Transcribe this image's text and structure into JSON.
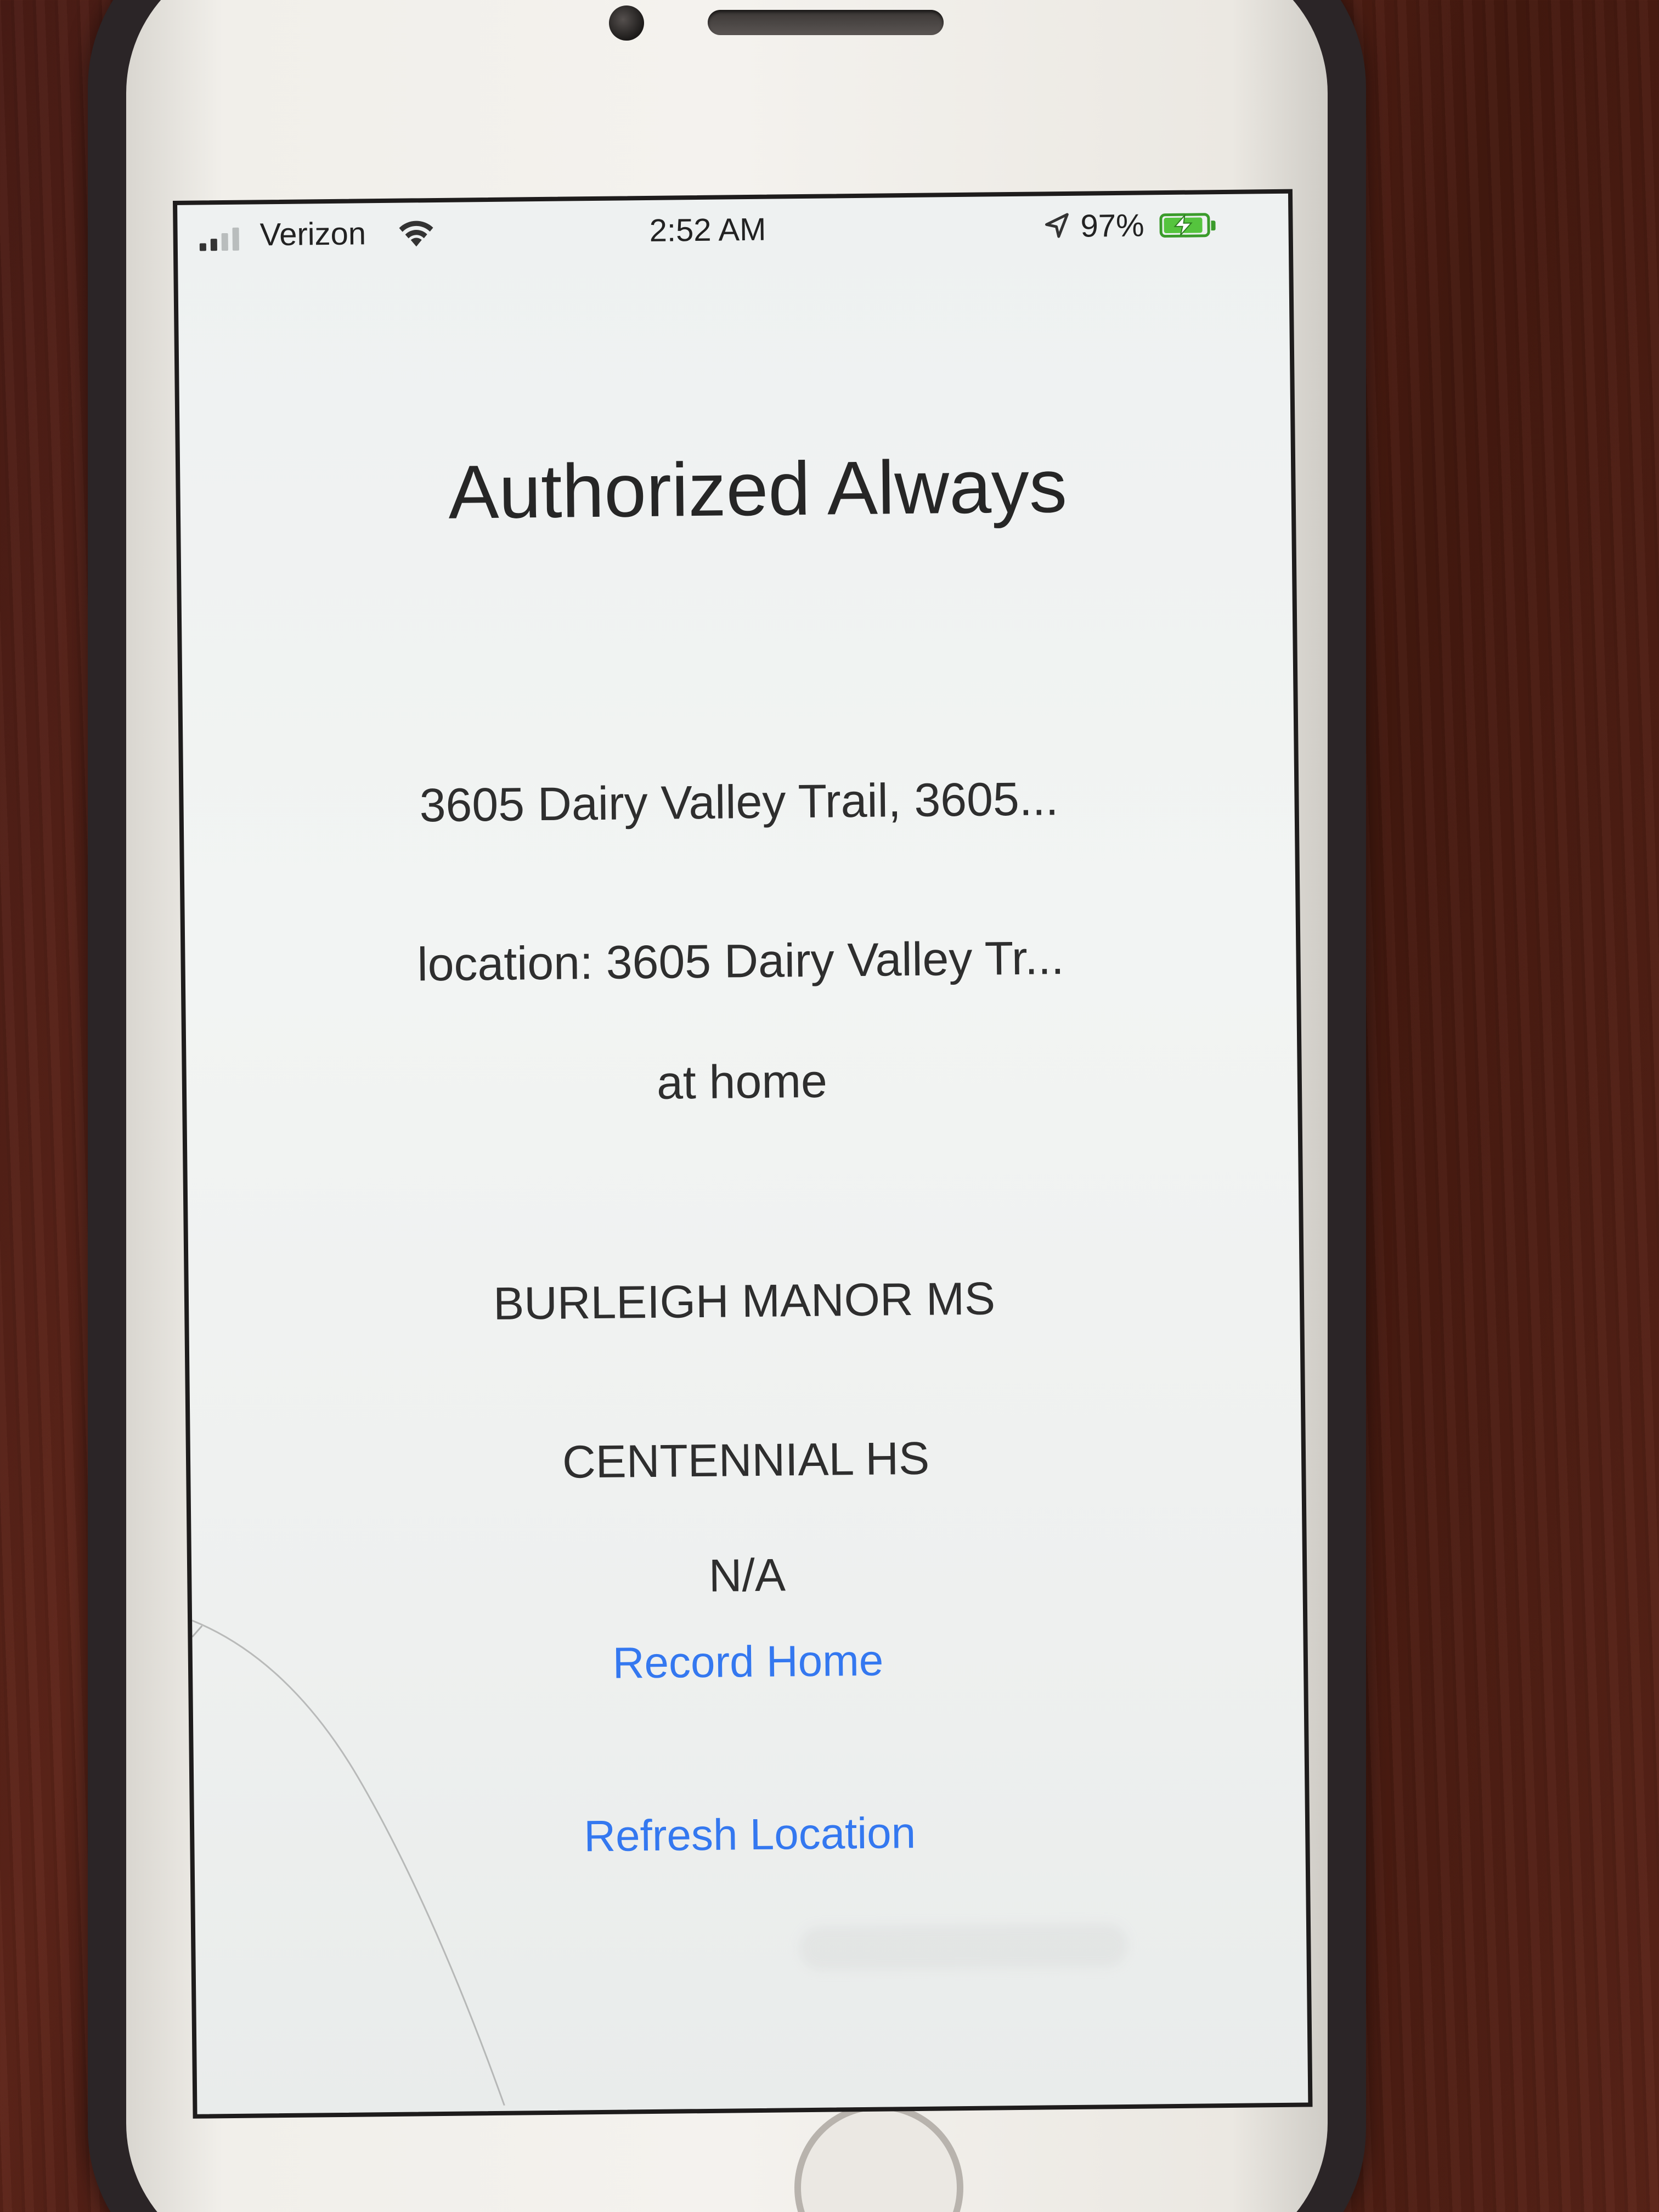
{
  "status_bar": {
    "carrier": "Verizon",
    "time": "2:52 AM",
    "battery_percent": "97%",
    "battery_level": 0.97,
    "signal_bars": 2,
    "signal_total": 4
  },
  "screen": {
    "title": "Authorized Always",
    "address": "3605 Dairy Valley Trail, 3605...",
    "location": "location: 3605 Dairy Valley Tr...",
    "home_status": "at home",
    "middle_school": "BURLEIGH MANOR MS",
    "high_school": "CENTENNIAL HS",
    "extra": "N/A",
    "record_home_label": "Record Home",
    "refresh_location_label": "Refresh Location"
  },
  "colors": {
    "link": "#3478f0",
    "battery_charging": "#55c43e"
  }
}
